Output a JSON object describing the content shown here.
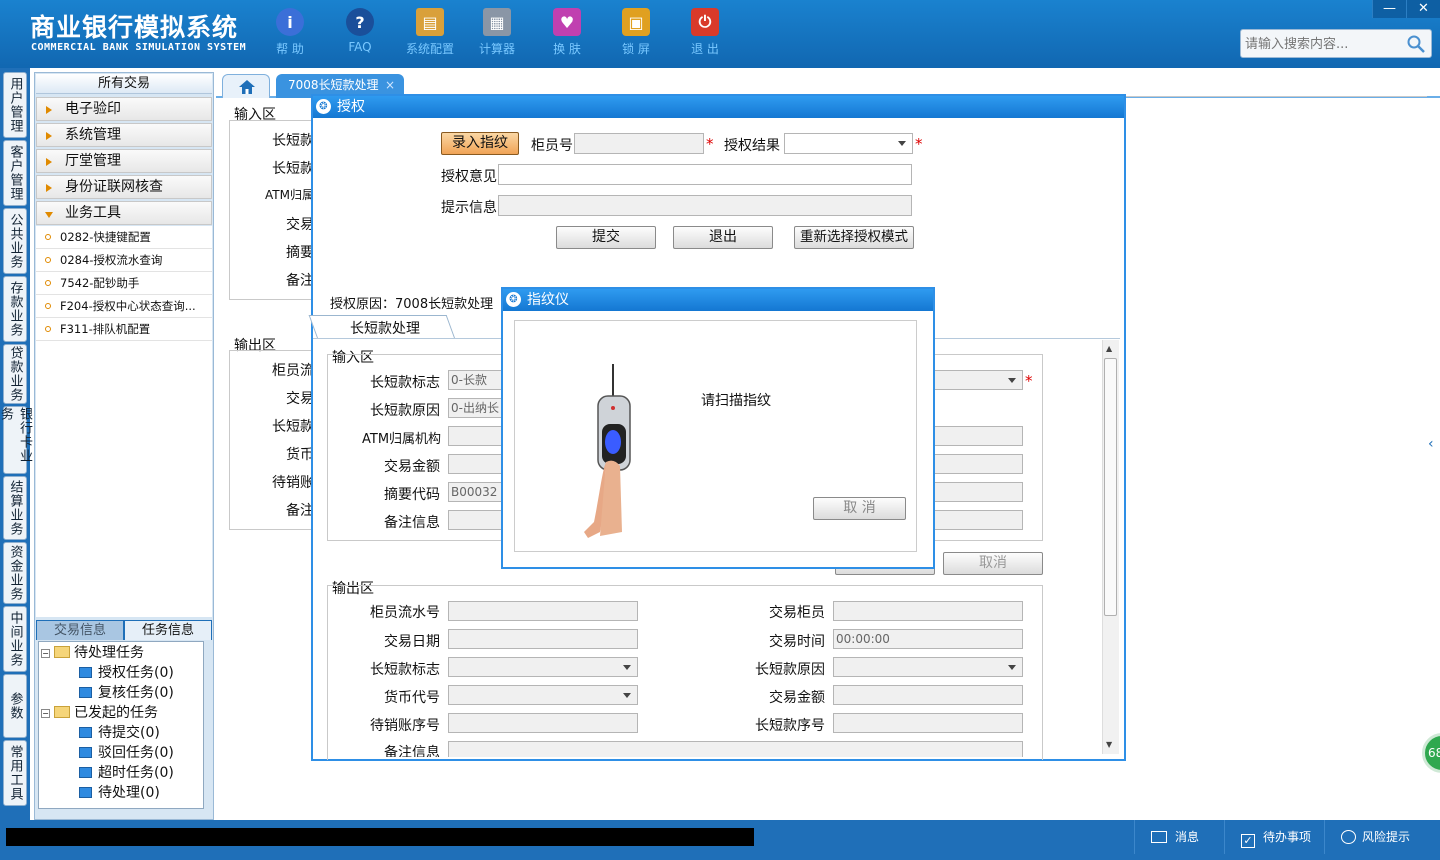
{
  "app": {
    "title_cn": "商业银行模拟系统",
    "title_en": "COMMERCIAL BANK SIMULATION SYSTEM"
  },
  "toolbar": {
    "items": [
      {
        "label": "帮 助",
        "icon": "info-icon",
        "color": "#3b6fd8"
      },
      {
        "label": "FAQ",
        "icon": "help-icon",
        "color": "#1a4f9a"
      },
      {
        "label": "系统配置",
        "icon": "toolbox-icon",
        "color": "#d9a03a"
      },
      {
        "label": "计算器",
        "icon": "calculator-icon",
        "color": "#8a96a6"
      },
      {
        "label": "换 肤",
        "icon": "shirt-icon",
        "color": "#c040b0"
      },
      {
        "label": "锁 屏",
        "icon": "lock-icon",
        "color": "#e0a020"
      },
      {
        "label": "退 出",
        "icon": "power-icon",
        "color": "#d93a2a"
      }
    ]
  },
  "window": {
    "minimize": "—",
    "close": "✕"
  },
  "search": {
    "placeholder": "请输入搜索内容..."
  },
  "vtabs": [
    "用户管理",
    "客户管理",
    "公共业务",
    "存款业务",
    "贷款业务",
    "银行卡业务",
    "结算业务",
    "资金业务",
    "中间业务",
    "参数",
    "常用工具"
  ],
  "menu": {
    "title": "所有交易",
    "groups": [
      "电子验印",
      "系统管理",
      "厅堂管理",
      "身份证联网核查",
      "业务工具"
    ],
    "items": [
      "0282-快捷键配置",
      "0284-授权流水查询",
      "7542-配钞助手",
      "F204-授权中心状态查询...",
      "F311-排队机配置"
    ]
  },
  "tasks": {
    "tabs": [
      "交易信息",
      "任务信息"
    ],
    "tree": {
      "pending": "待处理任务",
      "auth": "授权任务(0)",
      "review": "复核任务(0)",
      "initiated": "已发起的任务",
      "to_submit": "待提交(0)",
      "rejected": "驳回任务(0)",
      "timeout": "超时任务(0)",
      "to_process": "待处理(0)"
    }
  },
  "tabs": {
    "active": "7008长短款处理",
    "close": "×"
  },
  "bgform": {
    "input_area": "输入区",
    "labels": [
      "长短款",
      "长短款",
      "ATM归属",
      "交易",
      "摘要",
      "备注"
    ],
    "output_area": "输出区",
    "out_labels": [
      "柜员流",
      "交易",
      "长短款",
      "货币",
      "待销账",
      "备注"
    ]
  },
  "auth_dialog": {
    "title": "授权",
    "enter_fp_button": "录入指纹",
    "teller_no_label": "柜员号",
    "auth_result_label": "授权结果",
    "auth_opinion_label": "授权意见",
    "hint_label": "提示信息",
    "submit_button": "提交",
    "exit_button": "退出",
    "reselect_button": "重新选择授权模式",
    "reason": "授权原因：7008长短款处理",
    "subtab": "长短款处理"
  },
  "inner_form": {
    "input_area": "输入区",
    "flag_label": "长短款标志",
    "flag_value": "0-长款",
    "reason_label": "长短款原因",
    "reason_value": "0-出纳长",
    "atm_label": "ATM归属机构",
    "amount_label": "交易金额",
    "summary_label": "摘要代码",
    "summary_value": "B00032",
    "note_label": "备注信息",
    "cancel_button": "取消",
    "output_area": "输出区",
    "out": {
      "serial": "柜员流水号",
      "teller": "交易柜员",
      "date": "交易日期",
      "time": "交易时间",
      "time_value": "00:00:00",
      "flag": "长短款标志",
      "reason": "长短款原因",
      "currency": "货币代号",
      "amount": "交易金额",
      "account": "待销账序号",
      "seq": "长短款序号",
      "note": "备注信息"
    }
  },
  "fp_dialog": {
    "title": "指纹仪",
    "message": "请扫描指纹",
    "cancel_button": "取 消"
  },
  "status": {
    "messages": "消息",
    "todo": "待办事项",
    "risk": "风险提示",
    "badge": "68"
  }
}
